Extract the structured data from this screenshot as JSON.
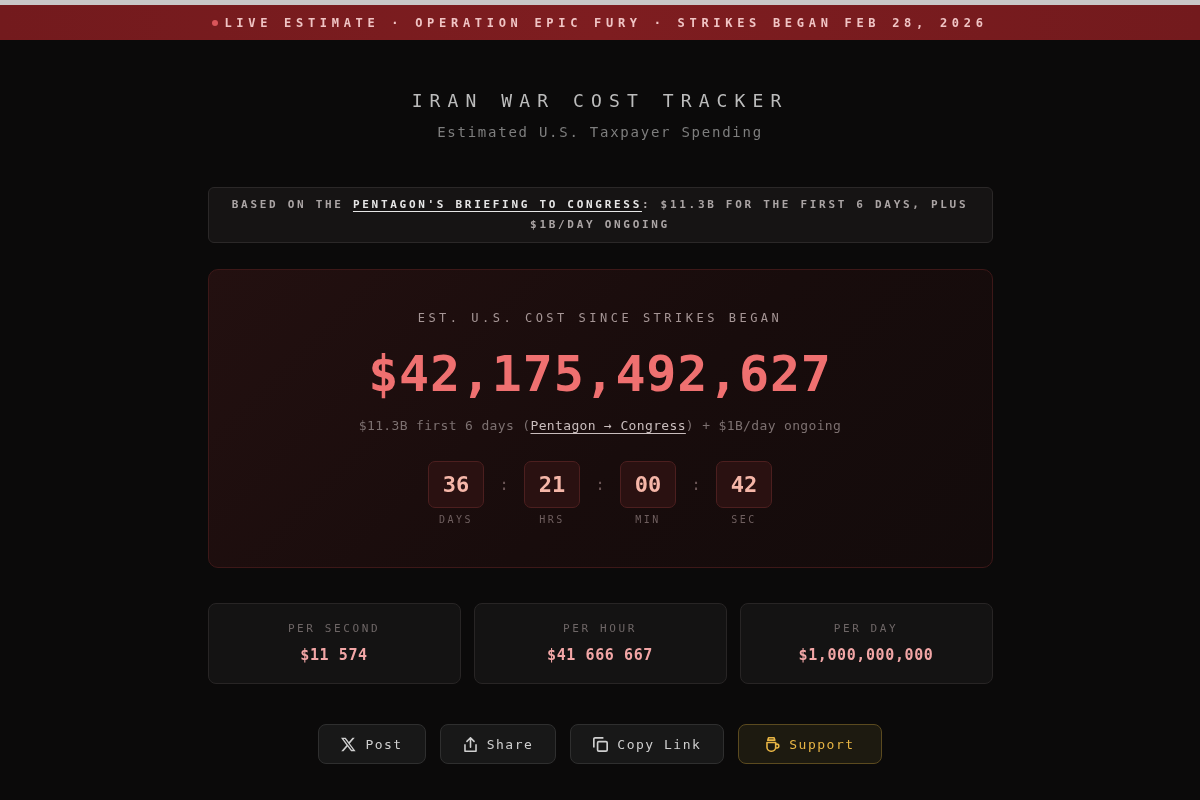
{
  "banner": {
    "text": "LIVE ESTIMATE · OPERATION EPIC FURY · STRIKES BEGAN FEB 28, 2026"
  },
  "header": {
    "title": "IRAN WAR COST TRACKER",
    "subtitle": "Estimated U.S. Taxpayer Spending"
  },
  "note": {
    "before": "BASED ON THE ",
    "link": "PENTAGON'S BRIEFING TO CONGRESS",
    "after": ": $11.3B FOR THE FIRST 6 DAYS, PLUS $1B/DAY ONGOING"
  },
  "counter": {
    "label": "EST. U.S. COST SINCE STRIKES BEGAN",
    "total": "$42,175,492,627",
    "breakdown": {
      "before": "$11.3B first 6 days (",
      "link": "Pentagon → Congress",
      "after": ") + $1B/day ongoing"
    },
    "timer": [
      {
        "value": "36",
        "unit": "DAYS"
      },
      {
        "separator": ":",
        "value": "21",
        "unit": "HRS"
      },
      {
        "separator": ":",
        "value": "00",
        "unit": "MIN"
      },
      {
        "separator": ":",
        "value": "42",
        "unit": "SEC"
      }
    ]
  },
  "rates": [
    {
      "label": "PER SECOND",
      "value": "$11 574"
    },
    {
      "label": "PER HOUR",
      "value": "$41 666 667"
    },
    {
      "label": "PER DAY",
      "value": "$1,000,000,000"
    }
  ],
  "actions": [
    {
      "kind": "post",
      "label": "Post"
    },
    {
      "kind": "share",
      "label": "Share"
    },
    {
      "kind": "copy",
      "label": "Copy Link"
    },
    {
      "kind": "support",
      "label": "Support"
    }
  ]
}
